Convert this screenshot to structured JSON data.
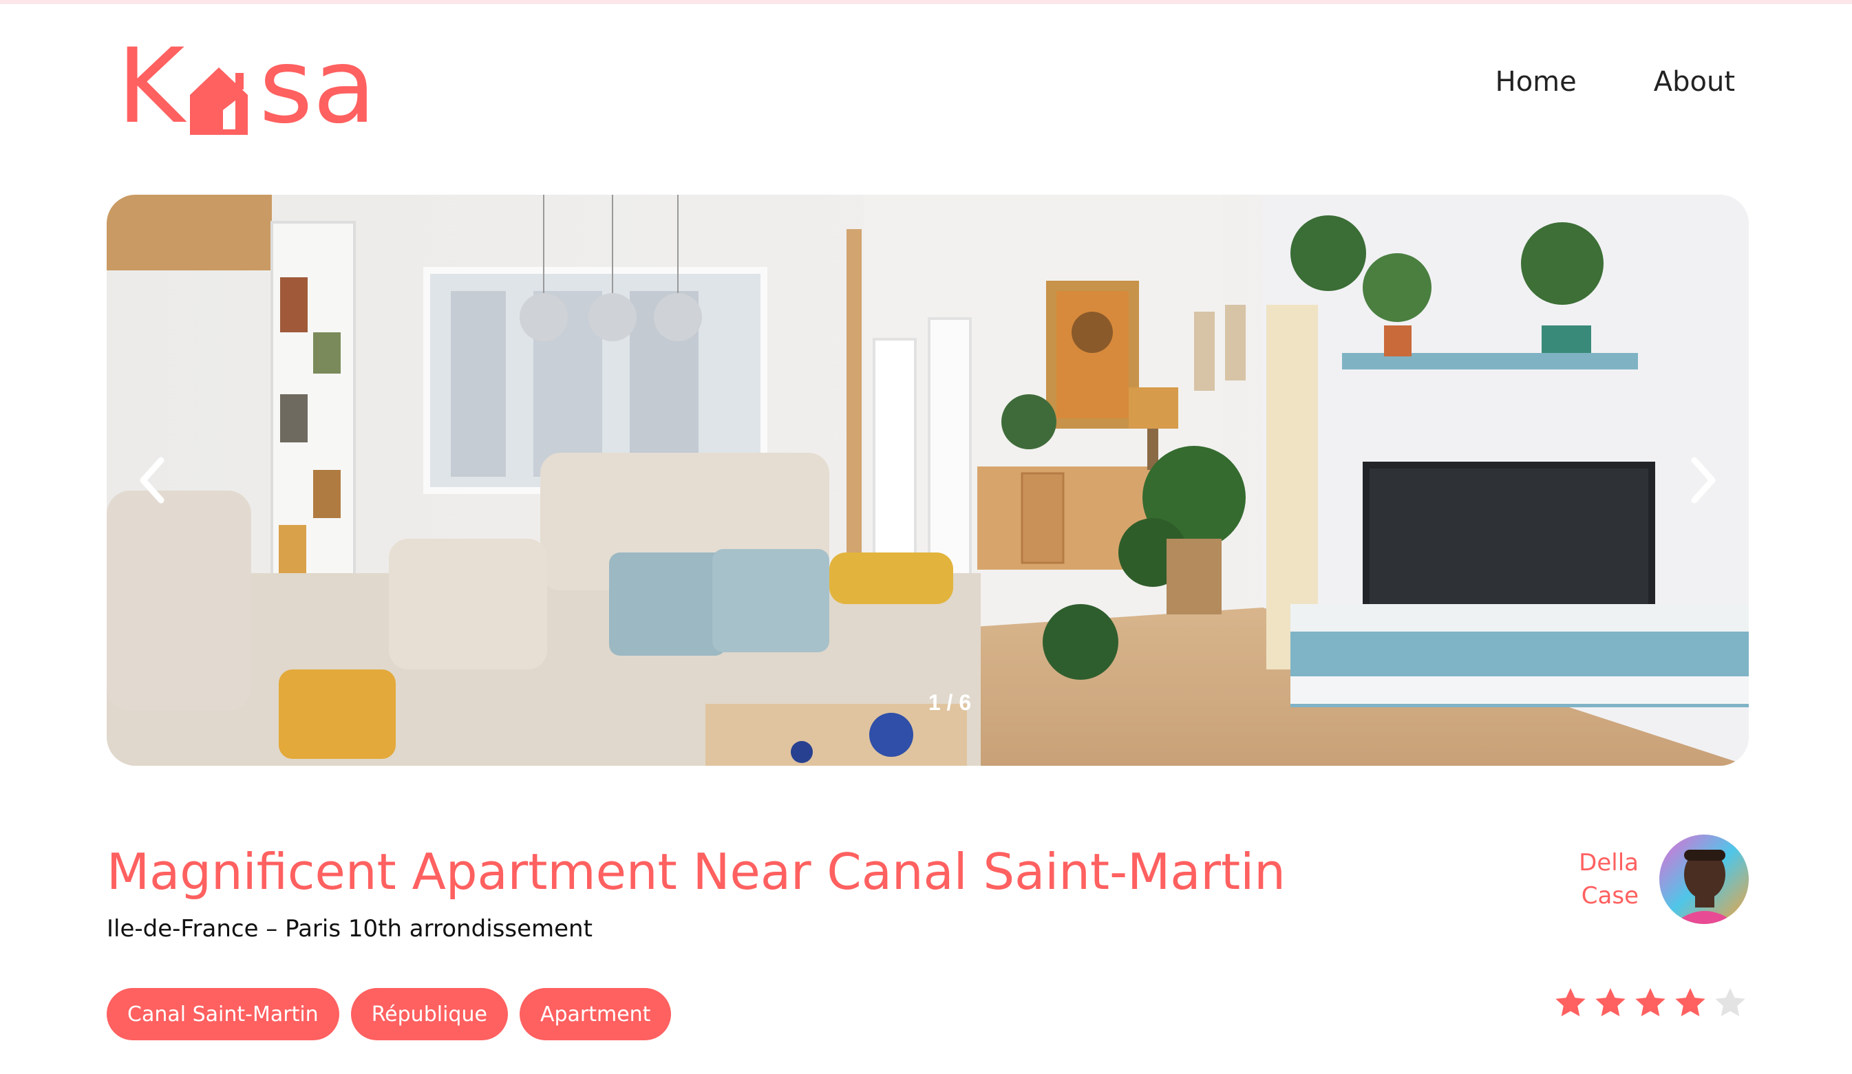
{
  "header": {
    "logo_text": "Kasa",
    "logo_parts": [
      "K",
      "sa"
    ],
    "nav": [
      {
        "label": "Home"
      },
      {
        "label": "About"
      }
    ]
  },
  "carousel": {
    "counter": "1 / 6",
    "current": 1,
    "total": 6,
    "prev_icon": "chevron-left-icon",
    "next_icon": "chevron-right-icon"
  },
  "listing": {
    "title": "Magnificent Apartment Near Canal Saint-Martin",
    "location": "Ile-de-France – Paris 10th arrondissement",
    "tags": [
      "Canal Saint-Martin",
      "République",
      "Apartment"
    ],
    "host": {
      "first_name": "Della",
      "last_name": "Case"
    },
    "rating": 4,
    "rating_max": 5
  },
  "colors": {
    "primary": "#FF6060",
    "star_empty": "#E3E3E3",
    "text": "#000000"
  }
}
